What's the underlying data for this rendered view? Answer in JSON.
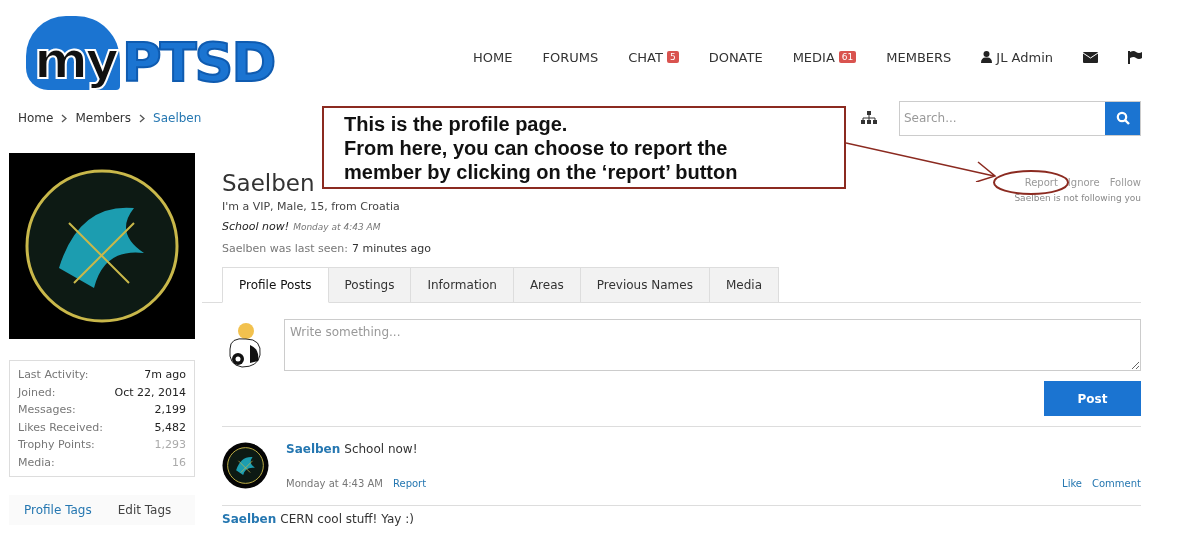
{
  "logo": {
    "dark": "my",
    "light": "PTSD"
  },
  "nav": [
    {
      "label": "HOME"
    },
    {
      "label": "FORUMS"
    },
    {
      "label": "CHAT",
      "badge": "5"
    },
    {
      "label": "DONATE"
    },
    {
      "label": "MEDIA",
      "badge": "61"
    },
    {
      "label": "MEMBERS"
    }
  ],
  "user_menu": {
    "label": "JL Admin"
  },
  "breadcrumb": [
    {
      "label": "Home",
      "selected": false
    },
    {
      "label": "Members",
      "selected": false
    },
    {
      "label": "Saelben",
      "selected": true
    }
  ],
  "search": {
    "placeholder": "Search..."
  },
  "sidebar": {
    "stats": [
      {
        "label": "Last Activity:",
        "value": "7m ago",
        "muted": false
      },
      {
        "label": "Joined:",
        "value": "Oct 22, 2014",
        "muted": false
      },
      {
        "label": "Messages:",
        "value": "2,199",
        "muted": false
      },
      {
        "label": "Likes Received:",
        "value": "5,482",
        "muted": false
      },
      {
        "label": "Trophy Points:",
        "value": "1,293",
        "muted": true
      },
      {
        "label": "Media:",
        "value": "16",
        "muted": true
      }
    ],
    "tags": [
      {
        "label": "Profile Tags",
        "selected": true
      },
      {
        "label": "Edit Tags",
        "selected": false
      }
    ]
  },
  "profile": {
    "name": "Saelben",
    "tagline": "I'm a VIP, Male, 15, from Croatia",
    "status": "School now!",
    "status_time": "Monday at 4:43 AM",
    "last_seen_label": "Saelben was last seen:",
    "last_seen": "7 minutes ago",
    "actions": [
      "Report",
      "Ignore",
      "Follow"
    ],
    "follow_note": "Saelben is not following you"
  },
  "tabs": [
    {
      "label": "Profile Posts",
      "selected": true
    },
    {
      "label": "Postings",
      "selected": false
    },
    {
      "label": "Information",
      "selected": false
    },
    {
      "label": "Areas",
      "selected": false
    },
    {
      "label": "Previous Names",
      "selected": false
    },
    {
      "label": "Media",
      "selected": false
    }
  ],
  "composer": {
    "placeholder": "Write something...",
    "button": "Post"
  },
  "posts": [
    {
      "author": "Saelben",
      "text": "School now!",
      "time": "Monday at 4:43 AM",
      "report": "Report",
      "actions": [
        "Like",
        "Comment"
      ]
    },
    {
      "author": "Saelben",
      "text": "CERN cool stuff! Yay :)"
    }
  ],
  "callout": {
    "lines": [
      "This is the profile page.",
      "From here, you can choose to report the",
      "member by clicking on the ‘report’ button"
    ]
  }
}
